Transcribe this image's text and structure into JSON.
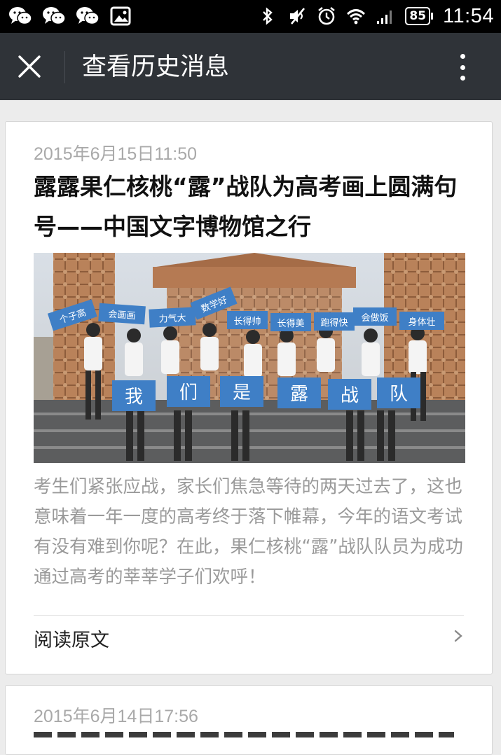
{
  "status_bar": {
    "left_icons": [
      "wechat-icon",
      "wechat-icon",
      "wechat-icon",
      "image-icon"
    ],
    "right_icons": [
      "bluetooth-icon",
      "mute-icon",
      "alarm-icon",
      "wifi-icon",
      "signal-icon"
    ],
    "battery": "85",
    "time": "11:54"
  },
  "title_bar": {
    "title": "查看历史消息",
    "close_icon": "close-icon",
    "more_icon": "more-vertical-icon"
  },
  "articles": [
    {
      "date": "2015年6月15日11:50",
      "title": "露露果仁核桃“露”战队为高考画上圆满句号——中国文字博物馆之行",
      "image_signs_top": [
        "个子高",
        "会画画",
        "力气大",
        "数学好",
        "长得帅",
        "长得美",
        "跑得快",
        "会做饭",
        "身体壮"
      ],
      "image_signs_bottom": [
        "我",
        "们",
        "是",
        "露",
        "战",
        "队"
      ],
      "summary": "考生们紧张应战，家长们焦急等待的两天过去了，这也意味着一年一度的高考终于落下帷幕，今年的语文考试有没有难到你呢？在此，果仁核桃“露”战队队员为成功通过高考的莘莘学子们欢呼！",
      "read_more": "阅读原文"
    },
    {
      "date": "2015年6月14日17:56"
    }
  ],
  "colors": {
    "status_bar_bg": "#000000",
    "title_bar_bg": "#2f3338",
    "page_bg": "#ececec",
    "card_bg": "#ffffff",
    "sign_blue": "#3f7fc6"
  }
}
